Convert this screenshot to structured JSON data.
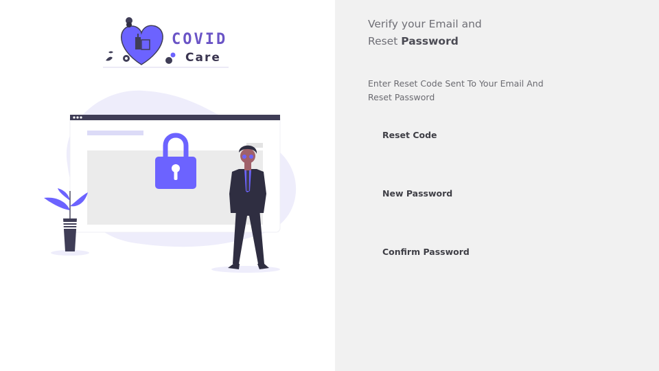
{
  "brand": {
    "logo_word_1": "COVID",
    "logo_word_2": "Care",
    "primary_color": "#6c63ff",
    "dark_color": "#3f3d56"
  },
  "illustration": {
    "subject": "person-standing-beside-locked-browser-window",
    "icons": [
      "lock-icon",
      "plant",
      "browser-window"
    ]
  },
  "form": {
    "heading_prefix": "Verify your Email and",
    "heading_line2_prefix": "Reset",
    "heading_bold": "Password",
    "subtitle": "Enter Reset Code Sent To Your Email And Reset Password",
    "fields": [
      {
        "label": "Reset Code",
        "value": "",
        "placeholder": ""
      },
      {
        "label": "New Password",
        "value": "",
        "placeholder": ""
      },
      {
        "label": "Confirm Password",
        "value": "",
        "placeholder": ""
      }
    ]
  },
  "colors": {
    "right_panel_bg": "#f1f1f1",
    "left_panel_bg": "#ffffff"
  }
}
